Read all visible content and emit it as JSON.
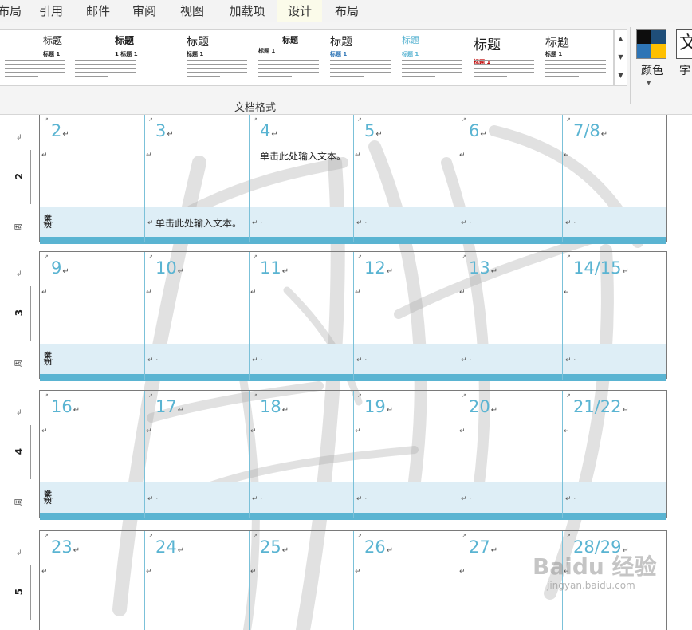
{
  "ribbon": {
    "tabs": [
      {
        "label": "布局",
        "active": false
      },
      {
        "label": "引用",
        "active": false
      },
      {
        "label": "邮件",
        "active": false
      },
      {
        "label": "审阅",
        "active": false
      },
      {
        "label": "视图",
        "active": false
      },
      {
        "label": "加载项",
        "active": false
      },
      {
        "label": "设计",
        "active": true
      },
      {
        "label": "布局",
        "active": false
      }
    ],
    "style_gallery": [
      {
        "heading": "标题",
        "sub": "标题 1"
      },
      {
        "heading": "标题",
        "sub": "1  标题 1"
      },
      {
        "heading": "标题",
        "sub": "标题 1"
      },
      {
        "heading": "标题",
        "sub": "标题 1"
      },
      {
        "heading": "标题",
        "sub": "标题 1"
      },
      {
        "heading": "标题",
        "sub": "标题 1"
      },
      {
        "heading": "标题",
        "sub": "标题 1"
      },
      {
        "heading": "标题",
        "sub": "标题 1"
      }
    ],
    "colors_label": "颜色",
    "fonts_glyph": "文",
    "fonts_label": "字",
    "group_label": "文档格式",
    "swatch_colors": [
      "#0d0d0d",
      "#1f4e79",
      "#2e75b6",
      "#ffc000"
    ],
    "accent_color": "#5ab4d2"
  },
  "calendar": {
    "notes_label": "注释",
    "week_char": "周",
    "placeholder_text": "单击此处输入文本。",
    "weeks": [
      {
        "week": "2",
        "days": [
          "2",
          "3",
          "4",
          "5",
          "6",
          "7/8"
        ]
      },
      {
        "week": "3",
        "days": [
          "9",
          "10",
          "11",
          "12",
          "13",
          "14/15"
        ]
      },
      {
        "week": "4",
        "days": [
          "16",
          "17",
          "18",
          "19",
          "20",
          "21/22"
        ]
      },
      {
        "week": "5",
        "days": [
          "23",
          "24",
          "25",
          "26",
          "27",
          "28/29"
        ]
      }
    ]
  },
  "watermark": {
    "baidu_logo": "Baidu 经验",
    "url": "jingyan.baidu.com"
  }
}
